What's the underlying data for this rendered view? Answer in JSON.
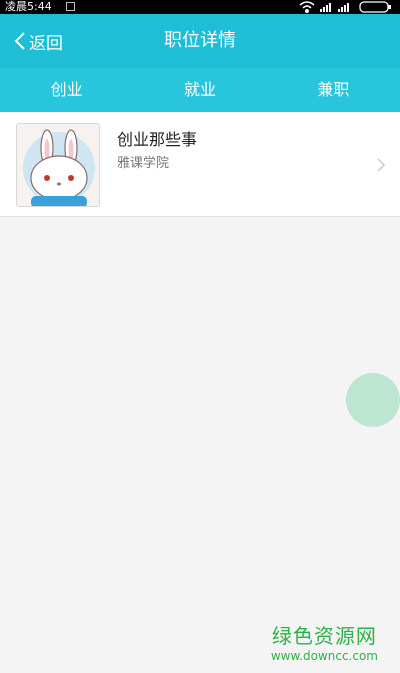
{
  "status_bar": {
    "time": "凌晨5:44"
  },
  "header": {
    "back_label": "返回",
    "title": "职位详情"
  },
  "tabs": [
    {
      "label": "创业"
    },
    {
      "label": "就业"
    },
    {
      "label": "兼职"
    }
  ],
  "list": [
    {
      "title": "创业那些事",
      "subtitle": "雅课学院"
    }
  ],
  "watermark": {
    "logo": "绿色资源网",
    "url": "www.downcc.com"
  },
  "colors": {
    "header": "#1ebed6",
    "tabs": "#29c5dc",
    "fab": "#bde6d2",
    "watermark": "#2fb14a"
  }
}
